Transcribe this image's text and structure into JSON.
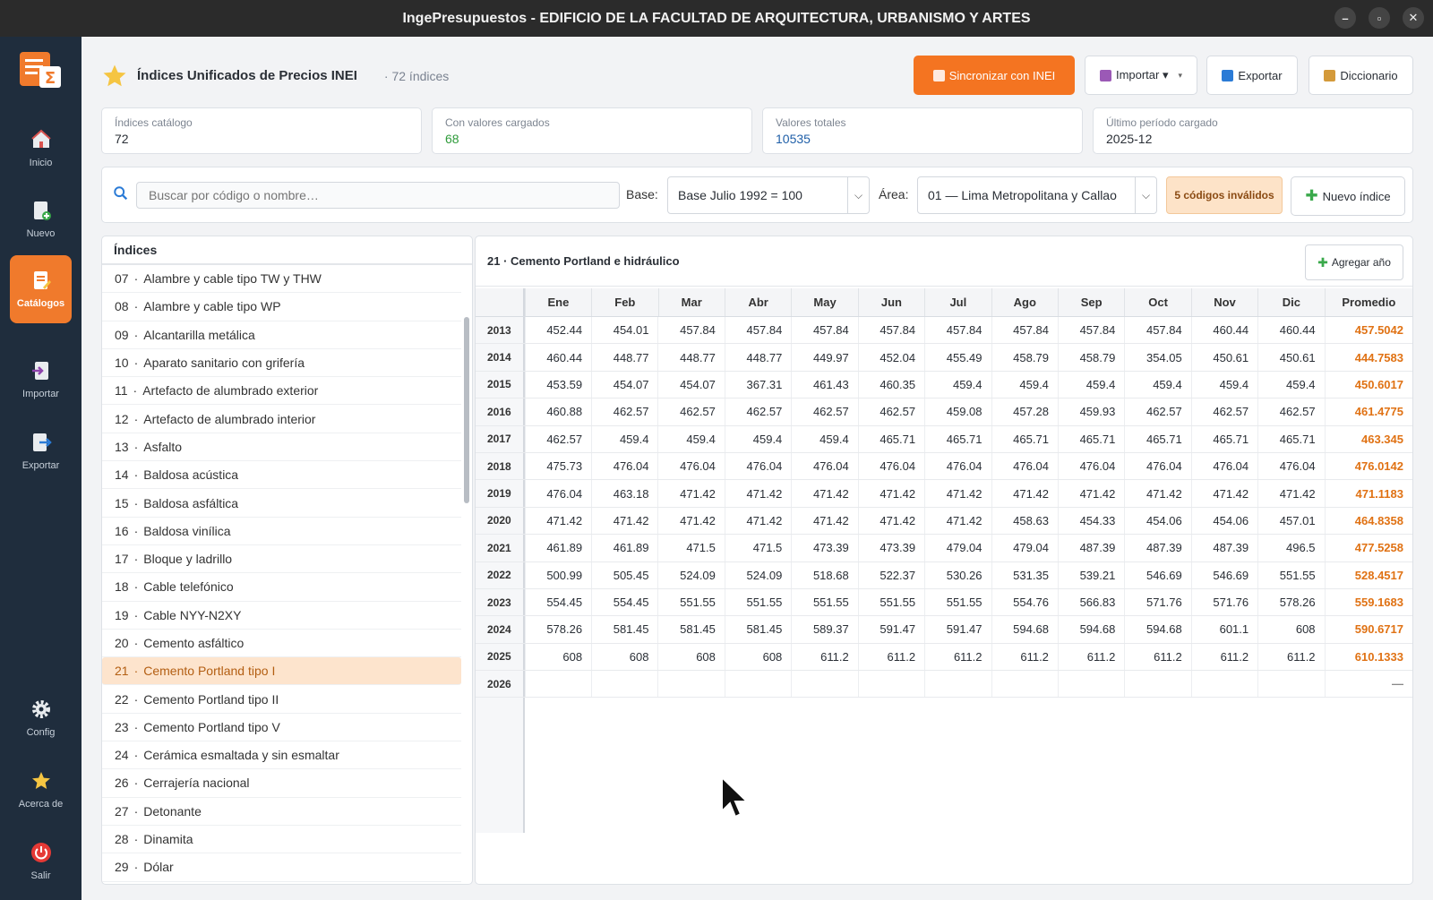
{
  "window": {
    "title": "IngePresupuestos  -  EDIFICIO DE LA FACULTAD DE ARQUITECTURA, URBANISMO Y ARTES",
    "minimize": "–",
    "maximize": "▫",
    "close": "✕"
  },
  "sidebar": {
    "items": [
      {
        "label": "Inicio",
        "icon": "home-icon"
      },
      {
        "label": "Nuevo",
        "icon": "new-document-icon"
      },
      {
        "label": "Catálogos",
        "icon": "catalog-icon",
        "active": true
      },
      {
        "label": "Importar",
        "icon": "import-icon"
      },
      {
        "label": "Exportar",
        "icon": "export-icon"
      },
      {
        "label": "Config",
        "icon": "gear-icon"
      },
      {
        "label": "Acerca de",
        "icon": "star-icon"
      },
      {
        "label": "Salir",
        "icon": "power-icon"
      }
    ]
  },
  "header": {
    "title": "Índices Unificados de Precios INEI",
    "count": "· 72 índices",
    "sync_label": "Sincronizar con INEI",
    "import_label": "Importar ▾",
    "export_label": "Exportar",
    "dictionary_label": "Diccionario"
  },
  "stats": [
    {
      "label": "Índices catálogo",
      "value": "72",
      "color": "#2a2f36"
    },
    {
      "label": "Con valores cargados",
      "value": "68",
      "color": "#2e9b3a"
    },
    {
      "label": "Valores totales",
      "value": "10535",
      "color": "#1f5fa8"
    },
    {
      "label": "Último período cargado",
      "value": "2025-12",
      "color": "#2a2f36"
    }
  ],
  "filters": {
    "search_placeholder": "Buscar por código o nombre…",
    "base_label": "Base:",
    "base_value": "Base Julio 1992 = 100",
    "area_label": "Área:",
    "area_value": "01 — Lima Metropolitana y Callao",
    "invalid_badge": "5 códigos inválidos",
    "new_index_label": "Nuevo índice"
  },
  "index_list": {
    "header": "Índices",
    "items": [
      {
        "code": "07",
        "name": "Alambre y cable tipo TW y THW"
      },
      {
        "code": "08",
        "name": "Alambre y cable tipo WP"
      },
      {
        "code": "09",
        "name": "Alcantarilla metálica"
      },
      {
        "code": "10",
        "name": "Aparato sanitario con grifería"
      },
      {
        "code": "11",
        "name": "Artefacto de alumbrado exterior"
      },
      {
        "code": "12",
        "name": "Artefacto de alumbrado interior"
      },
      {
        "code": "13",
        "name": "Asfalto"
      },
      {
        "code": "14",
        "name": "Baldosa acústica"
      },
      {
        "code": "15",
        "name": "Baldosa asfáltica"
      },
      {
        "code": "16",
        "name": "Baldosa vinílica"
      },
      {
        "code": "17",
        "name": "Bloque y ladrillo"
      },
      {
        "code": "18",
        "name": "Cable telefónico"
      },
      {
        "code": "19",
        "name": "Cable NYY-N2XY"
      },
      {
        "code": "20",
        "name": "Cemento asfáltico"
      },
      {
        "code": "21",
        "name": "Cemento Portland tipo I",
        "selected": true
      },
      {
        "code": "22",
        "name": "Cemento Portland tipo II"
      },
      {
        "code": "23",
        "name": "Cemento Portland tipo V"
      },
      {
        "code": "24",
        "name": "Cerámica esmaltada y sin esmaltar"
      },
      {
        "code": "26",
        "name": "Cerrajería nacional"
      },
      {
        "code": "27",
        "name": "Detonante"
      },
      {
        "code": "28",
        "name": "Dinamita"
      },
      {
        "code": "29",
        "name": "Dólar"
      }
    ]
  },
  "table": {
    "title": "21  ·  Cemento Portland e hidráulico",
    "add_year_label": "Agregar año",
    "columns": [
      "Ene",
      "Feb",
      "Mar",
      "Abr",
      "May",
      "Jun",
      "Jul",
      "Ago",
      "Sep",
      "Oct",
      "Nov",
      "Dic",
      "Promedio"
    ],
    "rows": [
      {
        "year": "2013",
        "values": [
          "452.44",
          "454.01",
          "457.84",
          "457.84",
          "457.84",
          "457.84",
          "457.84",
          "457.84",
          "457.84",
          "457.84",
          "460.44",
          "460.44"
        ],
        "avg": "457.5042"
      },
      {
        "year": "2014",
        "values": [
          "460.44",
          "448.77",
          "448.77",
          "448.77",
          "449.97",
          "452.04",
          "455.49",
          "458.79",
          "458.79",
          "354.05",
          "450.61",
          "450.61"
        ],
        "avg": "444.7583"
      },
      {
        "year": "2015",
        "values": [
          "453.59",
          "454.07",
          "454.07",
          "367.31",
          "461.43",
          "460.35",
          "459.4",
          "459.4",
          "459.4",
          "459.4",
          "459.4",
          "459.4"
        ],
        "avg": "450.6017"
      },
      {
        "year": "2016",
        "values": [
          "460.88",
          "462.57",
          "462.57",
          "462.57",
          "462.57",
          "462.57",
          "459.08",
          "457.28",
          "459.93",
          "462.57",
          "462.57",
          "462.57"
        ],
        "avg": "461.4775"
      },
      {
        "year": "2017",
        "values": [
          "462.57",
          "459.4",
          "459.4",
          "459.4",
          "459.4",
          "465.71",
          "465.71",
          "465.71",
          "465.71",
          "465.71",
          "465.71",
          "465.71"
        ],
        "avg": "463.345"
      },
      {
        "year": "2018",
        "values": [
          "475.73",
          "476.04",
          "476.04",
          "476.04",
          "476.04",
          "476.04",
          "476.04",
          "476.04",
          "476.04",
          "476.04",
          "476.04",
          "476.04"
        ],
        "avg": "476.0142"
      },
      {
        "year": "2019",
        "values": [
          "476.04",
          "463.18",
          "471.42",
          "471.42",
          "471.42",
          "471.42",
          "471.42",
          "471.42",
          "471.42",
          "471.42",
          "471.42",
          "471.42"
        ],
        "avg": "471.1183"
      },
      {
        "year": "2020",
        "values": [
          "471.42",
          "471.42",
          "471.42",
          "471.42",
          "471.42",
          "471.42",
          "471.42",
          "458.63",
          "454.33",
          "454.06",
          "454.06",
          "457.01"
        ],
        "avg": "464.8358"
      },
      {
        "year": "2021",
        "values": [
          "461.89",
          "461.89",
          "471.5",
          "471.5",
          "473.39",
          "473.39",
          "479.04",
          "479.04",
          "487.39",
          "487.39",
          "487.39",
          "496.5"
        ],
        "avg": "477.5258"
      },
      {
        "year": "2022",
        "values": [
          "500.99",
          "505.45",
          "524.09",
          "524.09",
          "518.68",
          "522.37",
          "530.26",
          "531.35",
          "539.21",
          "546.69",
          "546.69",
          "551.55"
        ],
        "avg": "528.4517"
      },
      {
        "year": "2023",
        "values": [
          "554.45",
          "554.45",
          "551.55",
          "551.55",
          "551.55",
          "551.55",
          "551.55",
          "554.76",
          "566.83",
          "571.76",
          "571.76",
          "578.26"
        ],
        "avg": "559.1683"
      },
      {
        "year": "2024",
        "values": [
          "578.26",
          "581.45",
          "581.45",
          "581.45",
          "589.37",
          "591.47",
          "591.47",
          "594.68",
          "594.68",
          "594.68",
          "601.1",
          "608"
        ],
        "avg": "590.6717"
      },
      {
        "year": "2025",
        "values": [
          "608",
          "608",
          "608",
          "608",
          "611.2",
          "611.2",
          "611.2",
          "611.2",
          "611.2",
          "611.2",
          "611.2",
          "611.2"
        ],
        "avg": "610.1333"
      },
      {
        "year": "2026",
        "values": [
          "",
          "",
          "",
          "",
          "",
          "",
          "",
          "",
          "",
          "",
          "",
          ""
        ],
        "avg": "—"
      }
    ]
  }
}
